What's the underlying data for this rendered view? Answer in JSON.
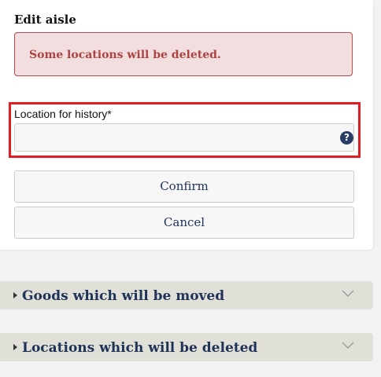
{
  "dialog": {
    "title": "Edit aisle",
    "alert_text": "Some locations will be deleted.",
    "field_label": "Location for history*",
    "field_value": "",
    "help_icon": "help-circle-icon",
    "confirm_label": "Confirm",
    "cancel_label": "Cancel"
  },
  "accordions": [
    {
      "title": "Goods which will be moved",
      "expanded": false
    },
    {
      "title": "Locations which will be deleted",
      "expanded": false
    }
  ],
  "colors": {
    "alert_bg": "#f2dede",
    "alert_text": "#a94442",
    "highlight_border": "#e01e24",
    "accent_navy": "#1e3357",
    "accordion_bg": "#e0dfd8"
  }
}
